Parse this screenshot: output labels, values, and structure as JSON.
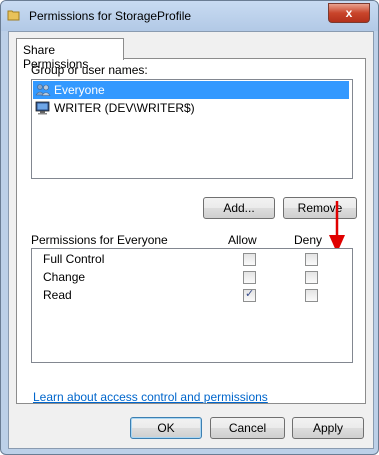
{
  "window": {
    "title": "Permissions for StorageProfile",
    "close_label": "x"
  },
  "tab": {
    "label": "Share Permissions"
  },
  "groups": {
    "label": "Group or user names:",
    "items": [
      {
        "name": "Everyone",
        "selected": true,
        "icon": "users-icon"
      },
      {
        "name": "WRITER (DEV\\WRITER$)",
        "selected": false,
        "icon": "computer-icon"
      }
    ],
    "add_label": "Add...",
    "remove_label": "Remove"
  },
  "permissions": {
    "label": "Permissions for Everyone",
    "allow_label": "Allow",
    "deny_label": "Deny",
    "rows": [
      {
        "name": "Full Control",
        "allow": false,
        "deny": false
      },
      {
        "name": "Change",
        "allow": false,
        "deny": false
      },
      {
        "name": "Read",
        "allow": true,
        "deny": false
      }
    ]
  },
  "link_text": "Learn about access control and permissions",
  "buttons": {
    "ok": "OK",
    "cancel": "Cancel",
    "apply": "Apply"
  },
  "colors": {
    "selection": "#3399ff",
    "link": "#0066cc",
    "arrow": "#e00000"
  }
}
